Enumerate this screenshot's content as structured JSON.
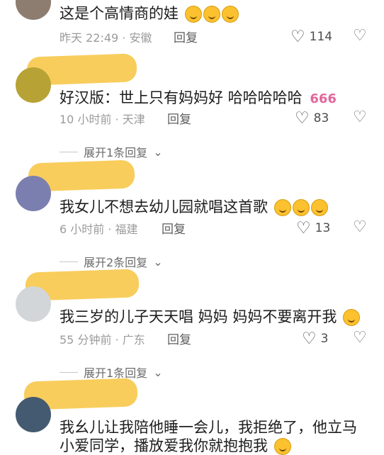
{
  "comments": [
    {
      "text": "这是个高情商的娃",
      "meta": "昨天 22:49 · 安徽",
      "reply": "回复",
      "likes": "114"
    },
    {
      "text": "好汉版：世上只有妈妈好 哈哈哈哈哈",
      "meta": "10 小时前 · 天津",
      "reply": "回复",
      "likes": "83",
      "expand": "展开1条回复"
    },
    {
      "text": "我女儿不想去幼儿园就唱这首歌",
      "meta": "6 小时前 · 福建",
      "reply": "回复",
      "likes": "13",
      "expand": "展开2条回复"
    },
    {
      "text": "我三岁的儿子天天唱 妈妈 妈妈不要离开我",
      "meta": "55 分钟前 · 广东",
      "reply": "回复",
      "likes": "3",
      "expand": "展开1条回复"
    },
    {
      "text_line1": "我幺儿让我陪他睡一会儿，我拒绝了，他立马",
      "text_line2": "小爱同学，播放爱我你就抱抱我"
    }
  ]
}
